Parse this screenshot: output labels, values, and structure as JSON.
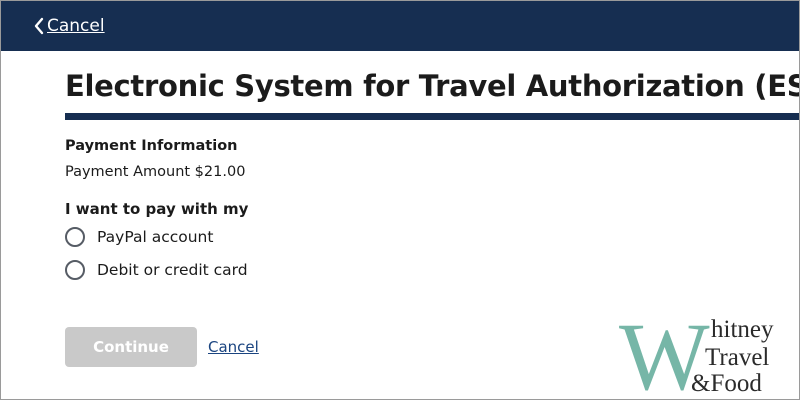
{
  "header": {
    "back_label": "Cancel"
  },
  "page": {
    "title": "Electronic System for Travel Authorization (ESTA)"
  },
  "payment": {
    "section_heading": "Payment Information",
    "amount_text": "Payment Amount $21.00",
    "method_prompt": "I want to pay with my",
    "options": [
      {
        "label": "PayPal account",
        "selected": false
      },
      {
        "label": "Debit or credit card",
        "selected": false
      }
    ]
  },
  "actions": {
    "continue_label": "Continue",
    "continue_disabled": true,
    "cancel_label": "Cancel"
  },
  "watermark": {
    "big_letter": "W",
    "line1": "hitney",
    "line2": "Travel",
    "line3": "&Food"
  },
  "colors": {
    "header_bg": "#162e51",
    "link": "#1a4480",
    "button_disabled": "#c9c9c9",
    "watermark_teal": "#6fb3a3"
  },
  "icons": {
    "back": "chevron-left-icon"
  }
}
